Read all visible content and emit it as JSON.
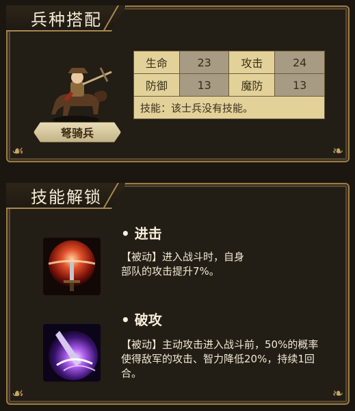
{
  "panel1": {
    "title": "兵种搭配",
    "unit_name": "弩骑兵",
    "stats": [
      {
        "label": "生命",
        "value": "23"
      },
      {
        "label": "攻击",
        "value": "24"
      },
      {
        "label": "防御",
        "value": "13"
      },
      {
        "label": "魔防",
        "value": "13"
      }
    ],
    "skill_note": "技能：该士兵没有技能。"
  },
  "panel2": {
    "title": "技能解锁",
    "skills": [
      {
        "name": "• 进击",
        "desc_line1": "【被动】进入战斗时，自身",
        "desc_line2": "部队的攻击提升7%。",
        "icon": "sword-red-orb-icon"
      },
      {
        "name": "• 破攻",
        "desc_line1": "【被动】主动攻击进入战斗前，50%的概率",
        "desc_line2": "使得敌军的攻击、智力降低20%，持续1回",
        "desc_line3": "合。",
        "icon": "purple-slash-icon"
      }
    ]
  },
  "colors": {
    "gold": "#a98952",
    "table_label": "#e2d29a",
    "table_value": "#a89b83"
  }
}
